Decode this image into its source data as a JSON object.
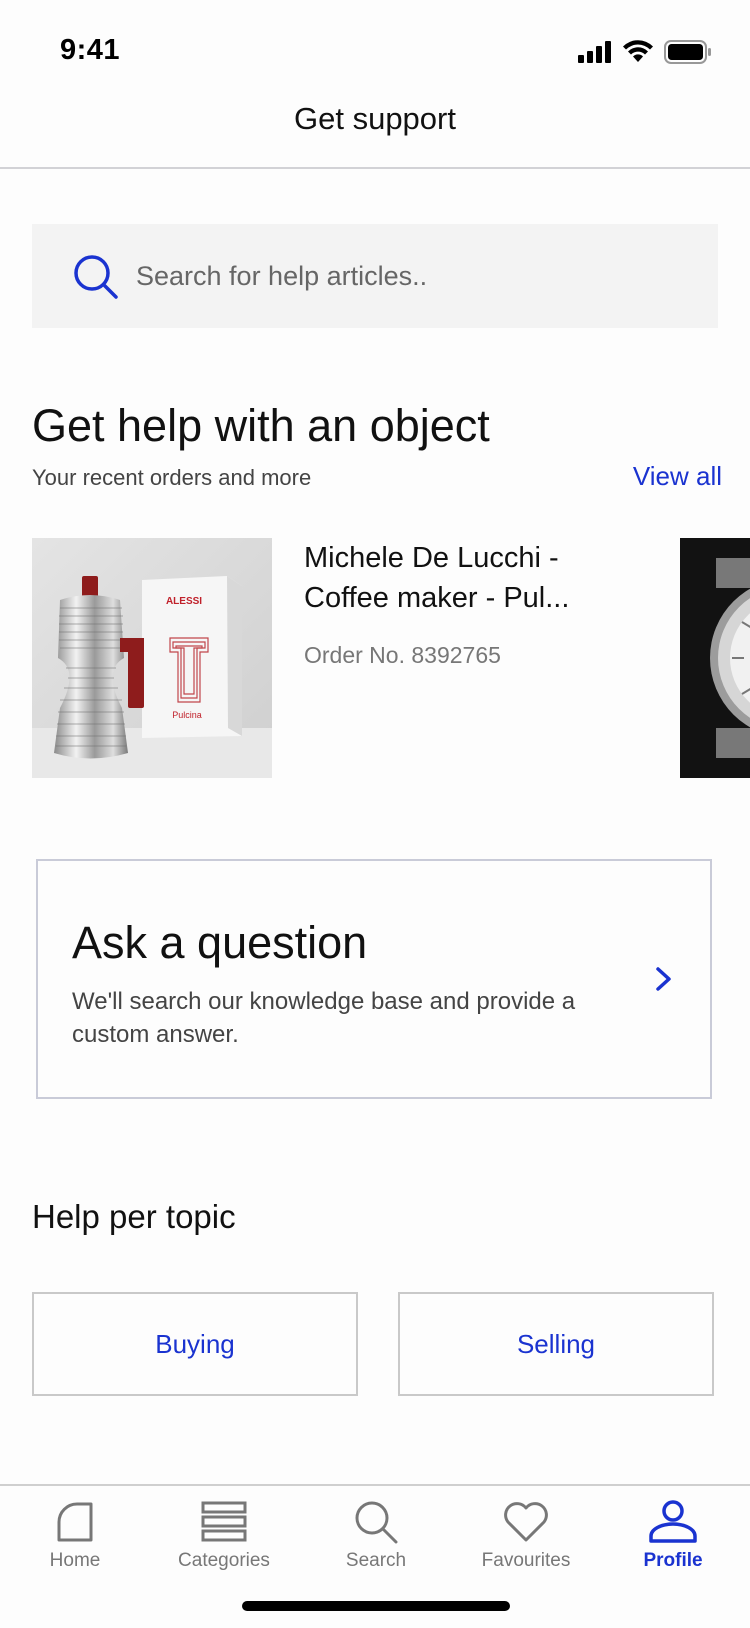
{
  "status_bar": {
    "time": "9:41"
  },
  "header": {
    "title": "Get support"
  },
  "search": {
    "placeholder": "Search for help articles.."
  },
  "objects_section": {
    "title": "Get help with an object",
    "subtitle": "Your recent orders and more",
    "view_all": "View all",
    "items": [
      {
        "name": "Michele De Lucchi - Coffee maker - Pul...",
        "order": "Order No. 8392765",
        "box_brand": "ALESSI",
        "box_label": "Pulcina"
      }
    ]
  },
  "ask": {
    "title": "Ask a question",
    "description": "We'll search our knowledge base and provide a custom answer."
  },
  "topics": {
    "title": "Help per topic",
    "buttons": [
      "Buying",
      "Selling"
    ]
  },
  "tab_bar": {
    "items": [
      {
        "label": "Home",
        "icon": "home-icon"
      },
      {
        "label": "Categories",
        "icon": "categories-icon"
      },
      {
        "label": "Search",
        "icon": "search-icon"
      },
      {
        "label": "Favourites",
        "icon": "heart-icon"
      },
      {
        "label": "Profile",
        "icon": "profile-icon"
      }
    ],
    "active": "Profile"
  },
  "colors": {
    "accent": "#1a33d0",
    "border": "#c9cbd8",
    "search_bg": "#f3f3f3"
  }
}
